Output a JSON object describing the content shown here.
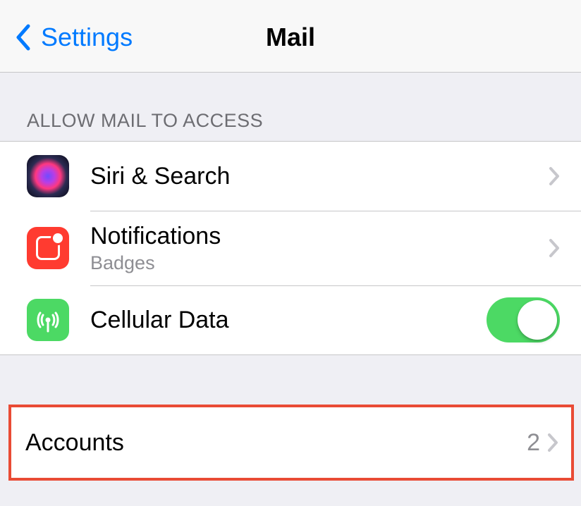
{
  "navbar": {
    "back_label": "Settings",
    "title": "Mail"
  },
  "section_allow": {
    "header": "ALLOW MAIL TO ACCESS",
    "rows": {
      "siri": {
        "label": "Siri & Search"
      },
      "notifications": {
        "label": "Notifications",
        "sublabel": "Badges"
      },
      "cellular": {
        "label": "Cellular Data",
        "toggle_on": true
      }
    }
  },
  "section_accounts": {
    "rows": {
      "accounts": {
        "label": "Accounts",
        "value": "2"
      }
    }
  }
}
